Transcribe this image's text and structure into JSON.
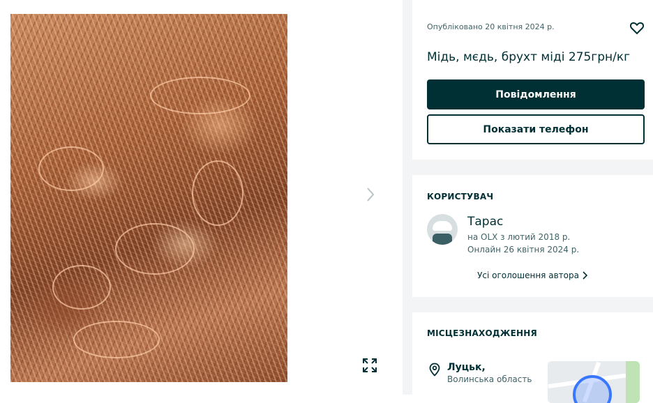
{
  "ad": {
    "published": "Опубліковано 20 квітня 2024 р.",
    "title": "Мідь, мєдь, брухт міді 275грн/кг"
  },
  "actions": {
    "message_label": "Повідомлення",
    "phone_label": "Показати телефон"
  },
  "user": {
    "heading": "КОРИСТУВАЧ",
    "name": "Тарас",
    "since": "на OLX з лютий 2018 р.",
    "online": "Онлайн 26 квітня 2024 р.",
    "all_ads_label": "Усі оголошення автора"
  },
  "location": {
    "heading": "МІСЦЕЗНАХОДЖЕННЯ",
    "city": "Луцьк,",
    "region": "Волинська область"
  },
  "icons": {
    "favorite": "heart-icon",
    "next": "chevron-right-icon",
    "expand": "expand-icon",
    "location": "map-pin-icon"
  },
  "colors": {
    "primary": "#002f34",
    "muted": "#406367",
    "background": "#f2f4f5"
  }
}
